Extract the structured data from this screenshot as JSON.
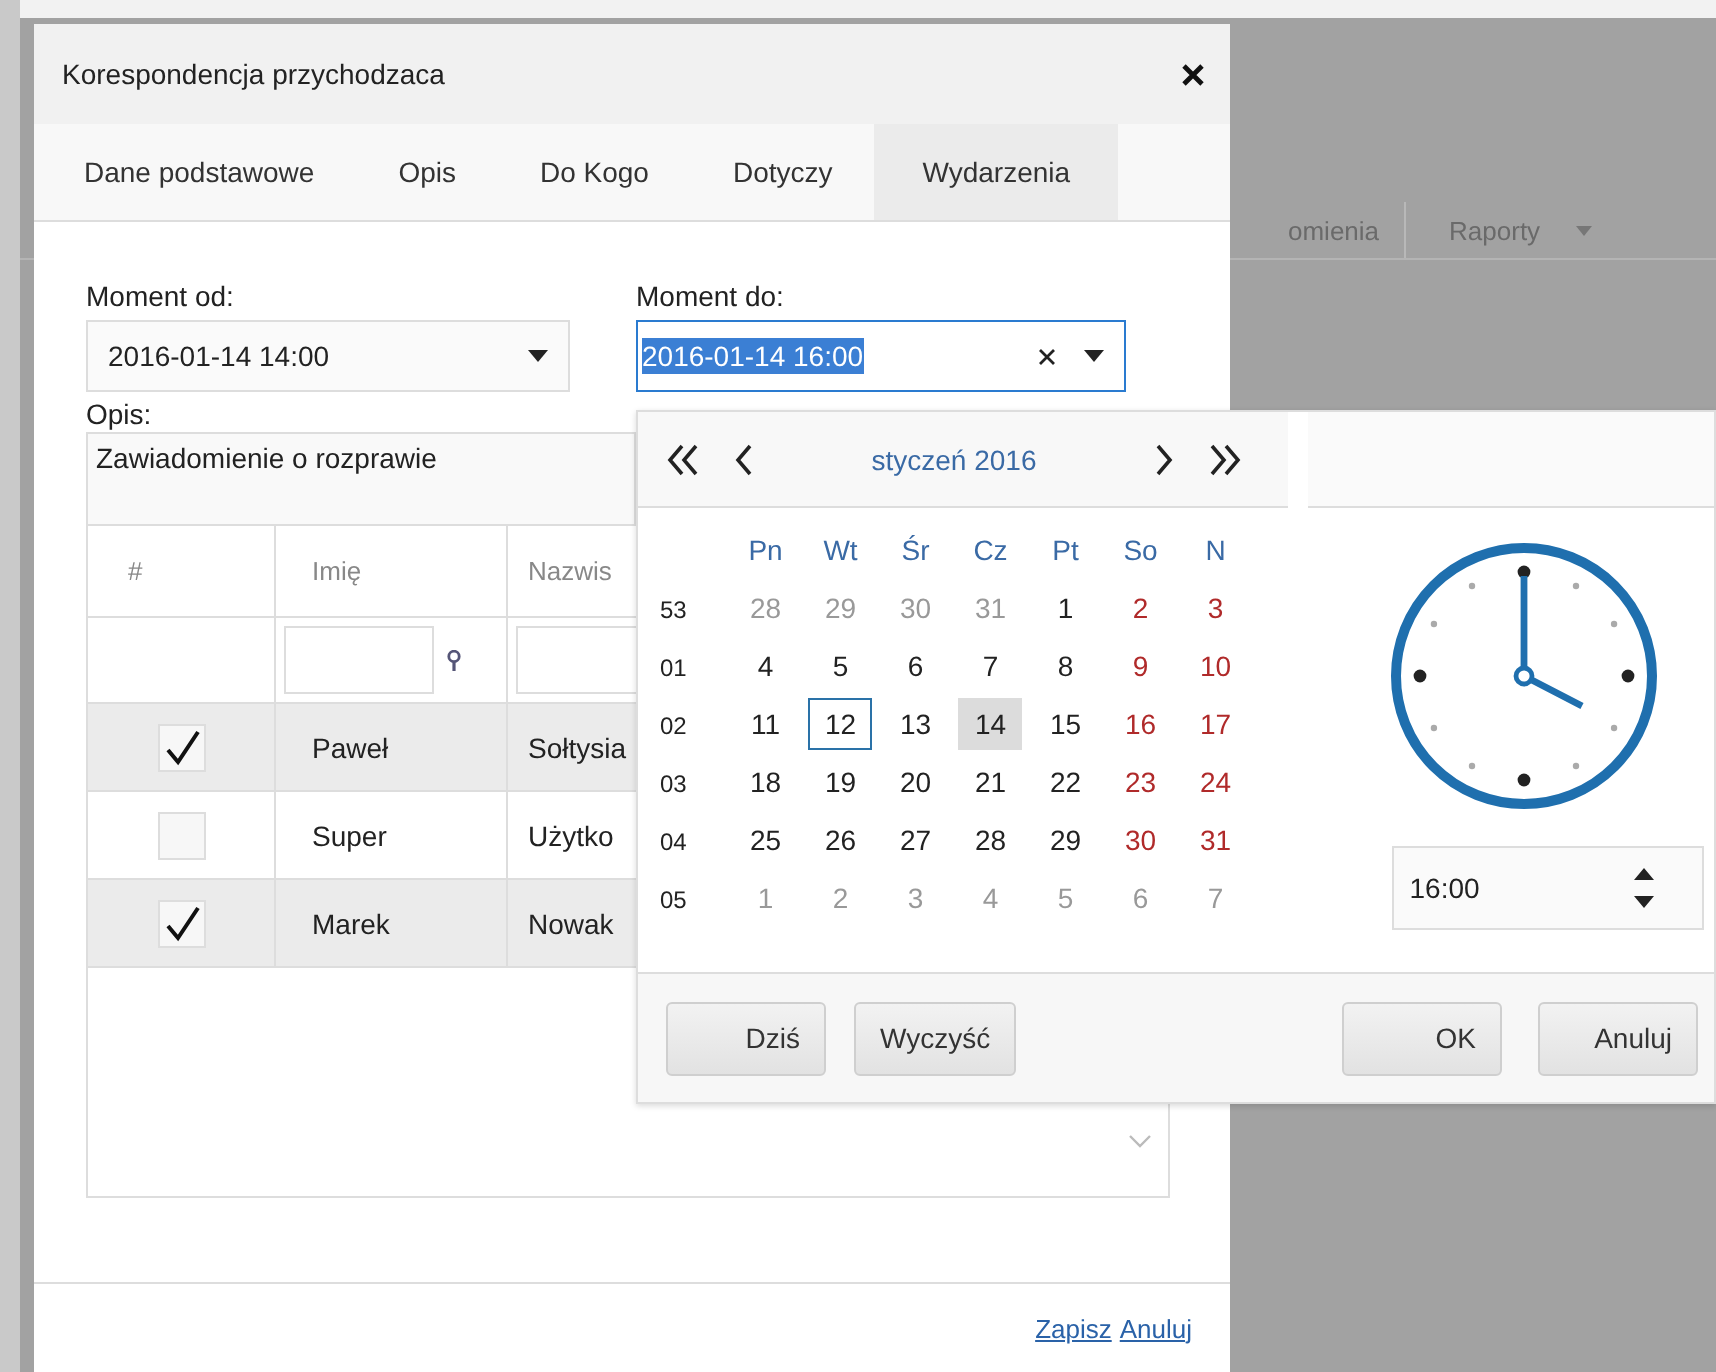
{
  "background_menu": [
    {
      "label": "omienia",
      "has_caret": false
    },
    {
      "label": "Raporty",
      "has_caret": true
    }
  ],
  "dialog": {
    "title": "Korespondencja przychodzaca",
    "tabs": [
      {
        "label": "Dane podstawowe",
        "selected": false
      },
      {
        "label": "Opis",
        "selected": false
      },
      {
        "label": "Do Kogo",
        "selected": false
      },
      {
        "label": "Dotyczy",
        "selected": false
      },
      {
        "label": "Wydarzenia",
        "selected": true
      }
    ],
    "moment_from": {
      "label": "Moment od:",
      "value": "2016-01-14 14:00",
      "focused": false
    },
    "moment_to": {
      "label": "Moment do:",
      "value": "2016-01-14 16:00",
      "focused": true
    },
    "description": {
      "label": "Opis:",
      "value": "Zawiadomienie o rozprawie"
    },
    "table": {
      "columns": [
        "#",
        "Imię",
        "Nazwis"
      ],
      "rows": [
        {
          "checked": true,
          "first_name": "Paweł",
          "last_name": "Sołtysia"
        },
        {
          "checked": false,
          "first_name": "Super",
          "last_name": "Użytko"
        },
        {
          "checked": true,
          "first_name": "Marek",
          "last_name": "Nowak"
        }
      ]
    },
    "footer_links": [
      "Zapisz",
      "Anuluj"
    ]
  },
  "calendar": {
    "month": "styczeń 2016",
    "weekdays": [
      "Pn",
      "Wt",
      "Śr",
      "Cz",
      "Pt",
      "So",
      "N"
    ],
    "weeks": [
      {
        "number": "53",
        "days": [
          {
            "day": "28",
            "kind": "other",
            "today": false,
            "selected": false
          },
          {
            "day": "29",
            "kind": "other",
            "today": false,
            "selected": false
          },
          {
            "day": "30",
            "kind": "other",
            "today": false,
            "selected": false
          },
          {
            "day": "31",
            "kind": "other",
            "today": false,
            "selected": false
          },
          {
            "day": "1",
            "kind": "normal",
            "today": false,
            "selected": false
          },
          {
            "day": "2",
            "kind": "weekend",
            "today": false,
            "selected": false
          },
          {
            "day": "3",
            "kind": "weekend",
            "today": false,
            "selected": false
          }
        ]
      },
      {
        "number": "01",
        "days": [
          {
            "day": "4",
            "kind": "normal",
            "today": false,
            "selected": false
          },
          {
            "day": "5",
            "kind": "normal",
            "today": false,
            "selected": false
          },
          {
            "day": "6",
            "kind": "normal",
            "today": false,
            "selected": false
          },
          {
            "day": "7",
            "kind": "normal",
            "today": false,
            "selected": false
          },
          {
            "day": "8",
            "kind": "normal",
            "today": false,
            "selected": false
          },
          {
            "day": "9",
            "kind": "weekend",
            "today": false,
            "selected": false
          },
          {
            "day": "10",
            "kind": "weekend",
            "today": false,
            "selected": false
          }
        ]
      },
      {
        "number": "02",
        "days": [
          {
            "day": "11",
            "kind": "normal",
            "today": false,
            "selected": false
          },
          {
            "day": "12",
            "kind": "normal",
            "today": true,
            "selected": false
          },
          {
            "day": "13",
            "kind": "normal",
            "today": false,
            "selected": false
          },
          {
            "day": "14",
            "kind": "normal",
            "today": false,
            "selected": true
          },
          {
            "day": "15",
            "kind": "normal",
            "today": false,
            "selected": false
          },
          {
            "day": "16",
            "kind": "weekend",
            "today": false,
            "selected": false
          },
          {
            "day": "17",
            "kind": "weekend",
            "today": false,
            "selected": false
          }
        ]
      },
      {
        "number": "03",
        "days": [
          {
            "day": "18",
            "kind": "normal",
            "today": false,
            "selected": false
          },
          {
            "day": "19",
            "kind": "normal",
            "today": false,
            "selected": false
          },
          {
            "day": "20",
            "kind": "normal",
            "today": false,
            "selected": false
          },
          {
            "day": "21",
            "kind": "normal",
            "today": false,
            "selected": false
          },
          {
            "day": "22",
            "kind": "normal",
            "today": false,
            "selected": false
          },
          {
            "day": "23",
            "kind": "weekend",
            "today": false,
            "selected": false
          },
          {
            "day": "24",
            "kind": "weekend",
            "today": false,
            "selected": false
          }
        ]
      },
      {
        "number": "04",
        "days": [
          {
            "day": "25",
            "kind": "normal",
            "today": false,
            "selected": false
          },
          {
            "day": "26",
            "kind": "normal",
            "today": false,
            "selected": false
          },
          {
            "day": "27",
            "kind": "normal",
            "today": false,
            "selected": false
          },
          {
            "day": "28",
            "kind": "normal",
            "today": false,
            "selected": false
          },
          {
            "day": "29",
            "kind": "normal",
            "today": false,
            "selected": false
          },
          {
            "day": "30",
            "kind": "weekend",
            "today": false,
            "selected": false
          },
          {
            "day": "31",
            "kind": "weekend",
            "today": false,
            "selected": false
          }
        ]
      },
      {
        "number": "05",
        "days": [
          {
            "day": "1",
            "kind": "other",
            "today": false,
            "selected": false
          },
          {
            "day": "2",
            "kind": "other",
            "today": false,
            "selected": false
          },
          {
            "day": "3",
            "kind": "other",
            "today": false,
            "selected": false
          },
          {
            "day": "4",
            "kind": "other",
            "today": false,
            "selected": false
          },
          {
            "day": "5",
            "kind": "other",
            "today": false,
            "selected": false
          },
          {
            "day": "6",
            "kind": "other",
            "today": false,
            "selected": false
          },
          {
            "day": "7",
            "kind": "other",
            "today": false,
            "selected": false
          }
        ]
      }
    ],
    "time": "16:00",
    "left_buttons": [
      "Dziś",
      "Wyczyść"
    ],
    "right_buttons": [
      "OK",
      "Anuluj"
    ]
  }
}
